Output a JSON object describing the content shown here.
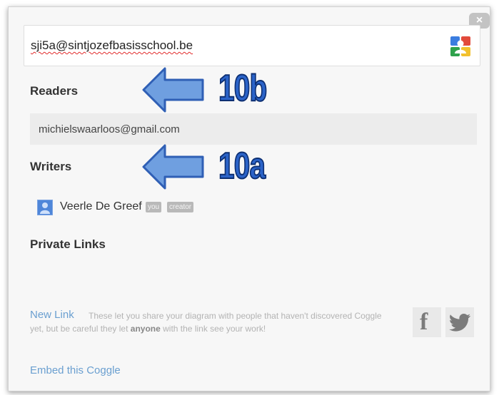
{
  "dialog": {
    "close_label": "×",
    "email_input": {
      "value": "sji5a@sintjozefbasisschool.be",
      "icon": "google-contacts-icon"
    },
    "readers": {
      "heading": "Readers",
      "items": [
        {
          "email": "michielswaarloos@gmail.com"
        }
      ]
    },
    "writers": {
      "heading": "Writers",
      "items": [
        {
          "name": "Veerle De Greef",
          "badges": [
            "you",
            "creator"
          ]
        }
      ]
    },
    "private_links": {
      "heading": "Private Links"
    },
    "new_link": {
      "label": "New Link",
      "description_prefix": "These let you share your diagram with people that haven't discovered Coggle yet, but be careful they let",
      "description_bold": "anyone",
      "description_suffix": "with the link see your work!"
    },
    "social": {
      "facebook": "f",
      "twitter": "twitter-icon"
    },
    "embed_label": "Embed this Coggle"
  },
  "annotations": {
    "readers_label": "10b",
    "writers_label": "10a"
  },
  "colors": {
    "link": "#6a9fd0",
    "annotation_fill": "#2b63c8",
    "annotation_outline": "#0d2f72",
    "arrow_fill": "#6f9fe0"
  }
}
